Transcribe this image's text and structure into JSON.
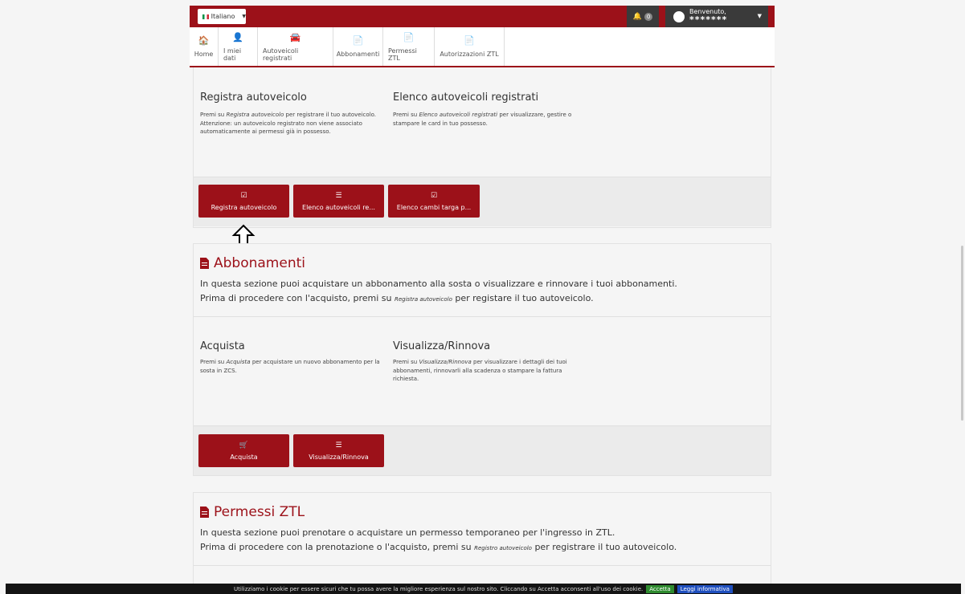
{
  "topbar": {
    "language": "Italiano",
    "notif_count": "0",
    "user_greeting": "Benvenuto,",
    "user_name": "*******"
  },
  "nav": {
    "items": [
      {
        "icon": "home-icon",
        "glyph": "🏠",
        "label": "Home"
      },
      {
        "icon": "user-icon",
        "glyph": "👤",
        "label": "I miei dati"
      },
      {
        "icon": "car-icon",
        "glyph": "🚘",
        "label": "Autoveicoli registrati"
      },
      {
        "icon": "document-icon",
        "glyph": "📄",
        "label": "Abbonamenti"
      },
      {
        "icon": "document-icon",
        "glyph": "📄",
        "label": "Permessi ZTL"
      },
      {
        "icon": "document-icon",
        "glyph": "📄",
        "label": "Autorizzazioni ZTL"
      }
    ]
  },
  "veicoli": {
    "col1_title": "Registra autoveicolo",
    "col1_desc_pre": "Premi su ",
    "col1_desc_em": "Registra autoveicolo",
    "col1_desc_post": " per registrare il tuo autoveicolo.",
    "col1_desc2": "Attenzione: un autoveicolo registrato non viene associato automaticamente ai permessi già in possesso.",
    "col2_title": "Elenco autoveicoli registrati",
    "col2_desc_pre": "Premi su ",
    "col2_desc_em": "Elenco autoveicoli registrati",
    "col2_desc_post": " per visualizzare, gestire o stampare le card in tuo possesso.",
    "buttons": [
      "Registra autoveicolo",
      "Elenco autoveicoli re...",
      "Elenco cambi targa p..."
    ]
  },
  "abbonamenti": {
    "title": "Abbonamenti",
    "line1": "In questa sezione puoi acquistare un abbonamento alla sosta o visualizzare e rinnovare i tuoi abbonamenti.",
    "line2_pre": "Prima di procedere con l'acquisto, premi su ",
    "line2_em": "Registra autoveicolo",
    "line2_post": " per registare il tuo autoveicolo.",
    "col1_title": "Acquista",
    "col1_desc_pre": "Premi su ",
    "col1_desc_em": "Acquista",
    "col1_desc_post": " per acquistare un nuovo abbonamento per la sosta in ZCS.",
    "col2_title": "Visualizza/Rinnova",
    "col2_desc_pre": "Premi su ",
    "col2_desc_em": "Visualizza/Rinnova",
    "col2_desc_post": " per visualizzare i dettagli dei tuoi abbonamenti, rinnovarli alla scadenza o stampare la fattura richiesta.",
    "buttons": [
      "Acquista",
      "Visualizza/Rinnova"
    ]
  },
  "permessi": {
    "title": "Permessi ZTL",
    "line1": "In questa sezione puoi prenotare o acquistare un permesso temporaneo per l'ingresso in ZTL.",
    "line2_pre": "Prima di procedere con la prenotazione o l'acquisto, premi su ",
    "line2_em": "Registro autoveicolo",
    "line2_post": " per registrare il tuo autoveicolo."
  },
  "cookie": {
    "text": "Utilizziamo i cookie per essere sicuri che tu possa avere la migliore esperienza sul nostro sito. Cliccando su Accetta acconsenti all'uso dei cookie.",
    "accept": "Accetta",
    "info": "Leggi informativa"
  }
}
